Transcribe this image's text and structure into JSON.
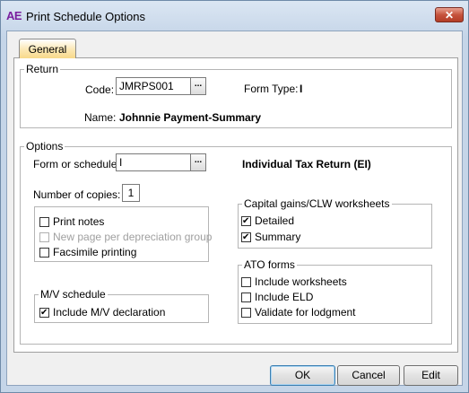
{
  "window": {
    "app_icon": "AE",
    "title": "Print Schedule Options",
    "close_label": "✕"
  },
  "tabs": [
    {
      "label": "General",
      "selected": true
    }
  ],
  "return_group": {
    "legend": "Return",
    "code_label": "Code:",
    "code_value": "JMRPS001",
    "code_button": "...",
    "form_type_label": "Form Type:",
    "form_type_value": "I",
    "name_label": "Name:",
    "name_value": "Johnnie Payment-Summary"
  },
  "options_group": {
    "legend": "Options",
    "form_label": "Form or schedule:",
    "form_value": "I",
    "form_button": "...",
    "form_description": "Individual Tax Return (EI)",
    "copies_label": "Number of copies:",
    "copies_value": "1"
  },
  "print_options": [
    {
      "label": "Print notes",
      "checked": false,
      "disabled": false
    },
    {
      "label": "New page per depreciation group",
      "checked": false,
      "disabled": true
    },
    {
      "label": "Facsimile printing",
      "checked": false,
      "disabled": false
    }
  ],
  "capital_gains": {
    "legend": "Capital gains/CLW worksheets",
    "items": [
      {
        "label": "Detailed",
        "checked": true
      },
      {
        "label": "Summary",
        "checked": true
      }
    ]
  },
  "mv_schedule": {
    "legend": "M/V schedule",
    "items": [
      {
        "label": "Include M/V declaration",
        "checked": true
      }
    ]
  },
  "ato_forms": {
    "legend": "ATO forms",
    "items": [
      {
        "label": "Include worksheets",
        "checked": false
      },
      {
        "label": "Include ELD",
        "checked": false
      },
      {
        "label": "Validate for lodgment",
        "checked": false
      }
    ]
  },
  "buttons": {
    "ok": "OK",
    "cancel": "Cancel",
    "edit": "Edit"
  },
  "colors": {
    "title_bar": "#c5d5e8",
    "close_button": "#c6533d",
    "tab_selected": "#f8d98a",
    "app_icon": "#7a1f9e"
  }
}
